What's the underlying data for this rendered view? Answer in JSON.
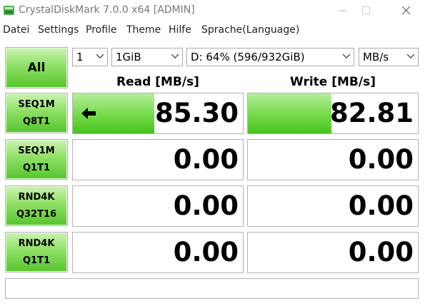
{
  "window": {
    "title": "CrystalDiskMark 7.0.0 x64 [ADMIN]"
  },
  "menu": [
    "Datei",
    "Settings",
    "Profile",
    "Theme",
    "Hilfe",
    "Sprache(Language)"
  ],
  "controls": {
    "all_label": "All",
    "count": "1",
    "size": "1GiB",
    "drive": "D: 64% (596/932GiB)",
    "unit": "MB/s"
  },
  "headers": {
    "read": "Read [MB/s]",
    "write": "Write [MB/s]"
  },
  "tests": [
    {
      "line1": "SEQ1M",
      "line2": "Q8T1",
      "read": "85.30",
      "write": "82.81",
      "read_fill": 0.48,
      "write_fill": 0.49,
      "active": true
    },
    {
      "line1": "SEQ1M",
      "line2": "Q1T1",
      "read": "0.00",
      "write": "0.00",
      "read_fill": 0,
      "write_fill": 0
    },
    {
      "line1": "RND4K",
      "line2": "Q32T16",
      "read": "0.00",
      "write": "0.00",
      "read_fill": 0,
      "write_fill": 0
    },
    {
      "line1": "RND4K",
      "line2": "Q1T1",
      "read": "0.00",
      "write": "0.00",
      "read_fill": 0,
      "write_fill": 0
    }
  ],
  "status_text": "",
  "colors": {
    "accent_green": "#55c52c",
    "bar_green": "#7adc4f",
    "border": "#b3b3b3"
  },
  "icons": {
    "app": "crystaldiskmark-icon",
    "active_test": "left-arrow-icon"
  }
}
